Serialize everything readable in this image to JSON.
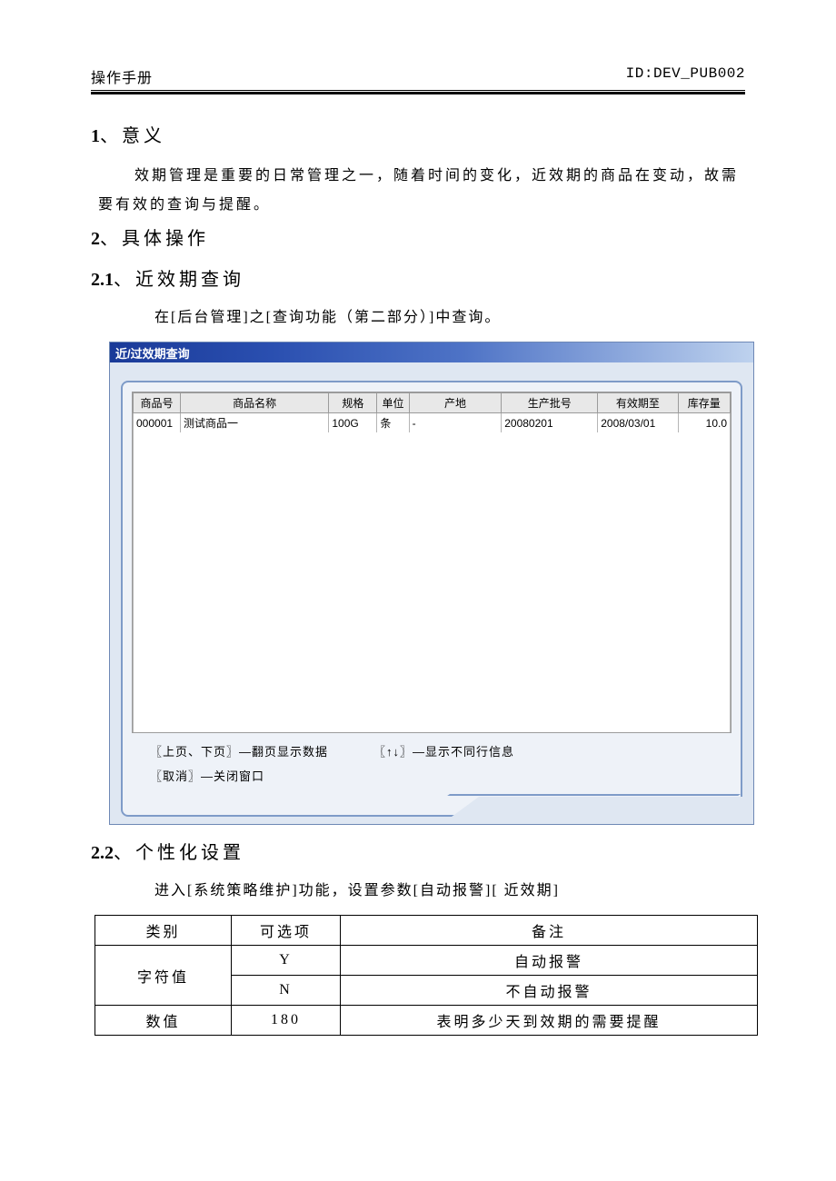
{
  "header": {
    "left": "操作手册",
    "right": "ID:DEV_PUB002"
  },
  "sections": {
    "s1": {
      "num": "1",
      "dot": "、",
      "title": "意义",
      "para": "效期管理是重要的日常管理之一，随着时间的变化，近效期的商品在变动，故需要有效的查询与提醒。"
    },
    "s2": {
      "num": "2",
      "dot": "、",
      "title": "具体操作"
    },
    "s21": {
      "num": "2.1",
      "dot": "、",
      "title": "近效期查询",
      "para": "在[后台管理]之[查询功能（第二部分）]中查询。"
    },
    "s22": {
      "num": "2.2",
      "dot": "、",
      "title": "个性化设置",
      "para": "进入[系统策略维护]功能，设置参数[自动报警][ 近效期]"
    }
  },
  "embed": {
    "title": "近/过效期查询",
    "columns": [
      "商品号",
      "商品名称",
      "规格",
      "单位",
      "产地",
      "生产批号",
      "有效期至",
      "库存量"
    ],
    "rows": [
      {
        "id": "000001",
        "name": "测试商品一",
        "spec": "100G",
        "unit": "条",
        "origin": "-",
        "batch": "20080201",
        "exp": "2008/03/01",
        "stock": "10.0"
      }
    ],
    "hints": {
      "page": "〖上页、下页〗—翻页显示数据",
      "arrows": "〖↑↓〗—显示不同行信息",
      "cancel": "〖取消〗—关闭窗口"
    }
  },
  "settings": {
    "headers": [
      "类别",
      "可选项",
      "备注"
    ],
    "rows": [
      {
        "cat": "字符值",
        "opt": "Y",
        "note": "自动报警",
        "rowspan": 2
      },
      {
        "cat": "",
        "opt": "N",
        "note": "不自动报警"
      },
      {
        "cat": "数值",
        "opt": "180",
        "note": "表明多少天到效期的需要提醒"
      }
    ]
  }
}
